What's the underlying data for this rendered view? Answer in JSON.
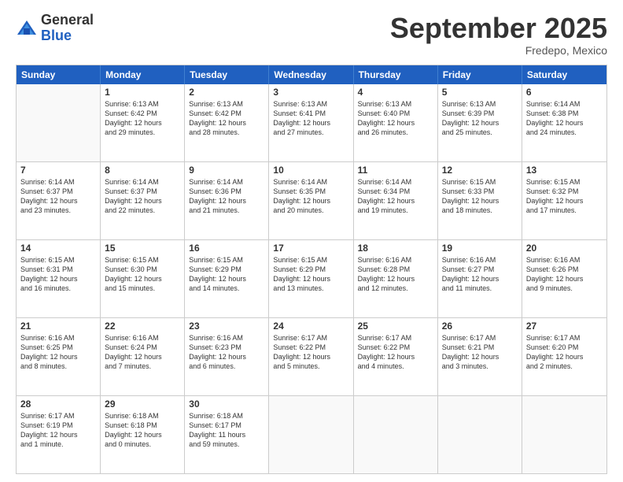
{
  "logo": {
    "general": "General",
    "blue": "Blue"
  },
  "header": {
    "month": "September 2025",
    "location": "Fredepo, Mexico"
  },
  "weekdays": [
    "Sunday",
    "Monday",
    "Tuesday",
    "Wednesday",
    "Thursday",
    "Friday",
    "Saturday"
  ],
  "weeks": [
    [
      {
        "day": "",
        "info": ""
      },
      {
        "day": "1",
        "info": "Sunrise: 6:13 AM\nSunset: 6:42 PM\nDaylight: 12 hours\nand 29 minutes."
      },
      {
        "day": "2",
        "info": "Sunrise: 6:13 AM\nSunset: 6:42 PM\nDaylight: 12 hours\nand 28 minutes."
      },
      {
        "day": "3",
        "info": "Sunrise: 6:13 AM\nSunset: 6:41 PM\nDaylight: 12 hours\nand 27 minutes."
      },
      {
        "day": "4",
        "info": "Sunrise: 6:13 AM\nSunset: 6:40 PM\nDaylight: 12 hours\nand 26 minutes."
      },
      {
        "day": "5",
        "info": "Sunrise: 6:13 AM\nSunset: 6:39 PM\nDaylight: 12 hours\nand 25 minutes."
      },
      {
        "day": "6",
        "info": "Sunrise: 6:14 AM\nSunset: 6:38 PM\nDaylight: 12 hours\nand 24 minutes."
      }
    ],
    [
      {
        "day": "7",
        "info": "Sunrise: 6:14 AM\nSunset: 6:37 PM\nDaylight: 12 hours\nand 23 minutes."
      },
      {
        "day": "8",
        "info": "Sunrise: 6:14 AM\nSunset: 6:37 PM\nDaylight: 12 hours\nand 22 minutes."
      },
      {
        "day": "9",
        "info": "Sunrise: 6:14 AM\nSunset: 6:36 PM\nDaylight: 12 hours\nand 21 minutes."
      },
      {
        "day": "10",
        "info": "Sunrise: 6:14 AM\nSunset: 6:35 PM\nDaylight: 12 hours\nand 20 minutes."
      },
      {
        "day": "11",
        "info": "Sunrise: 6:14 AM\nSunset: 6:34 PM\nDaylight: 12 hours\nand 19 minutes."
      },
      {
        "day": "12",
        "info": "Sunrise: 6:15 AM\nSunset: 6:33 PM\nDaylight: 12 hours\nand 18 minutes."
      },
      {
        "day": "13",
        "info": "Sunrise: 6:15 AM\nSunset: 6:32 PM\nDaylight: 12 hours\nand 17 minutes."
      }
    ],
    [
      {
        "day": "14",
        "info": "Sunrise: 6:15 AM\nSunset: 6:31 PM\nDaylight: 12 hours\nand 16 minutes."
      },
      {
        "day": "15",
        "info": "Sunrise: 6:15 AM\nSunset: 6:30 PM\nDaylight: 12 hours\nand 15 minutes."
      },
      {
        "day": "16",
        "info": "Sunrise: 6:15 AM\nSunset: 6:29 PM\nDaylight: 12 hours\nand 14 minutes."
      },
      {
        "day": "17",
        "info": "Sunrise: 6:15 AM\nSunset: 6:29 PM\nDaylight: 12 hours\nand 13 minutes."
      },
      {
        "day": "18",
        "info": "Sunrise: 6:16 AM\nSunset: 6:28 PM\nDaylight: 12 hours\nand 12 minutes."
      },
      {
        "day": "19",
        "info": "Sunrise: 6:16 AM\nSunset: 6:27 PM\nDaylight: 12 hours\nand 11 minutes."
      },
      {
        "day": "20",
        "info": "Sunrise: 6:16 AM\nSunset: 6:26 PM\nDaylight: 12 hours\nand 9 minutes."
      }
    ],
    [
      {
        "day": "21",
        "info": "Sunrise: 6:16 AM\nSunset: 6:25 PM\nDaylight: 12 hours\nand 8 minutes."
      },
      {
        "day": "22",
        "info": "Sunrise: 6:16 AM\nSunset: 6:24 PM\nDaylight: 12 hours\nand 7 minutes."
      },
      {
        "day": "23",
        "info": "Sunrise: 6:16 AM\nSunset: 6:23 PM\nDaylight: 12 hours\nand 6 minutes."
      },
      {
        "day": "24",
        "info": "Sunrise: 6:17 AM\nSunset: 6:22 PM\nDaylight: 12 hours\nand 5 minutes."
      },
      {
        "day": "25",
        "info": "Sunrise: 6:17 AM\nSunset: 6:22 PM\nDaylight: 12 hours\nand 4 minutes."
      },
      {
        "day": "26",
        "info": "Sunrise: 6:17 AM\nSunset: 6:21 PM\nDaylight: 12 hours\nand 3 minutes."
      },
      {
        "day": "27",
        "info": "Sunrise: 6:17 AM\nSunset: 6:20 PM\nDaylight: 12 hours\nand 2 minutes."
      }
    ],
    [
      {
        "day": "28",
        "info": "Sunrise: 6:17 AM\nSunset: 6:19 PM\nDaylight: 12 hours\nand 1 minute."
      },
      {
        "day": "29",
        "info": "Sunrise: 6:18 AM\nSunset: 6:18 PM\nDaylight: 12 hours\nand 0 minutes."
      },
      {
        "day": "30",
        "info": "Sunrise: 6:18 AM\nSunset: 6:17 PM\nDaylight: 11 hours\nand 59 minutes."
      },
      {
        "day": "",
        "info": ""
      },
      {
        "day": "",
        "info": ""
      },
      {
        "day": "",
        "info": ""
      },
      {
        "day": "",
        "info": ""
      }
    ]
  ]
}
